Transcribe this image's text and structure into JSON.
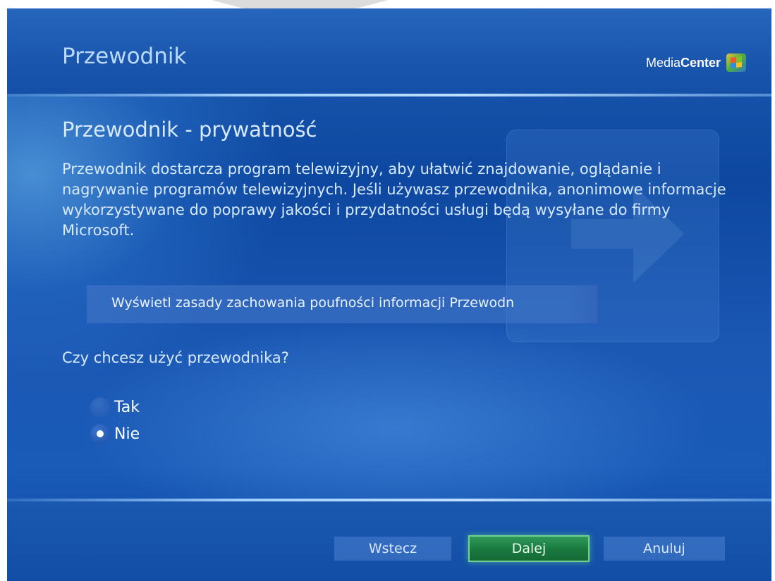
{
  "header": {
    "title": "Przewodnik",
    "brand_prefix": "Media",
    "brand_bold": "Center"
  },
  "section": {
    "title": "Przewodnik - prywatność",
    "description": "Przewodnik dostarcza program telewizyjny, aby ułatwić znajdowanie, oglądanie i nagrywanie programów telewizyjnych. Jeśli używasz przewodnika, anonimowe informacje wykorzystywane do poprawy jakości i przydatności usługi będą wysyłane do firmy Microsoft.",
    "privacy_link": "Wyświetl zasady zachowania poufności informacji Przewodn"
  },
  "question": {
    "text": "Czy chcesz użyć przewodnika?",
    "options": [
      {
        "label": "Tak",
        "selected": false
      },
      {
        "label": "Nie",
        "selected": true
      }
    ]
  },
  "footer": {
    "back_label": "Wstecz",
    "next_label": "Dalej",
    "cancel_label": "Anuluj"
  },
  "colors": {
    "background": "#1a56ad",
    "text": "#d6e9ff",
    "primary_button": "#1b7b40"
  },
  "icons": {
    "logo": "windows-flag-icon",
    "radio_selected": "radio-selected-icon",
    "radio_unselected": "radio-unselected-icon"
  }
}
